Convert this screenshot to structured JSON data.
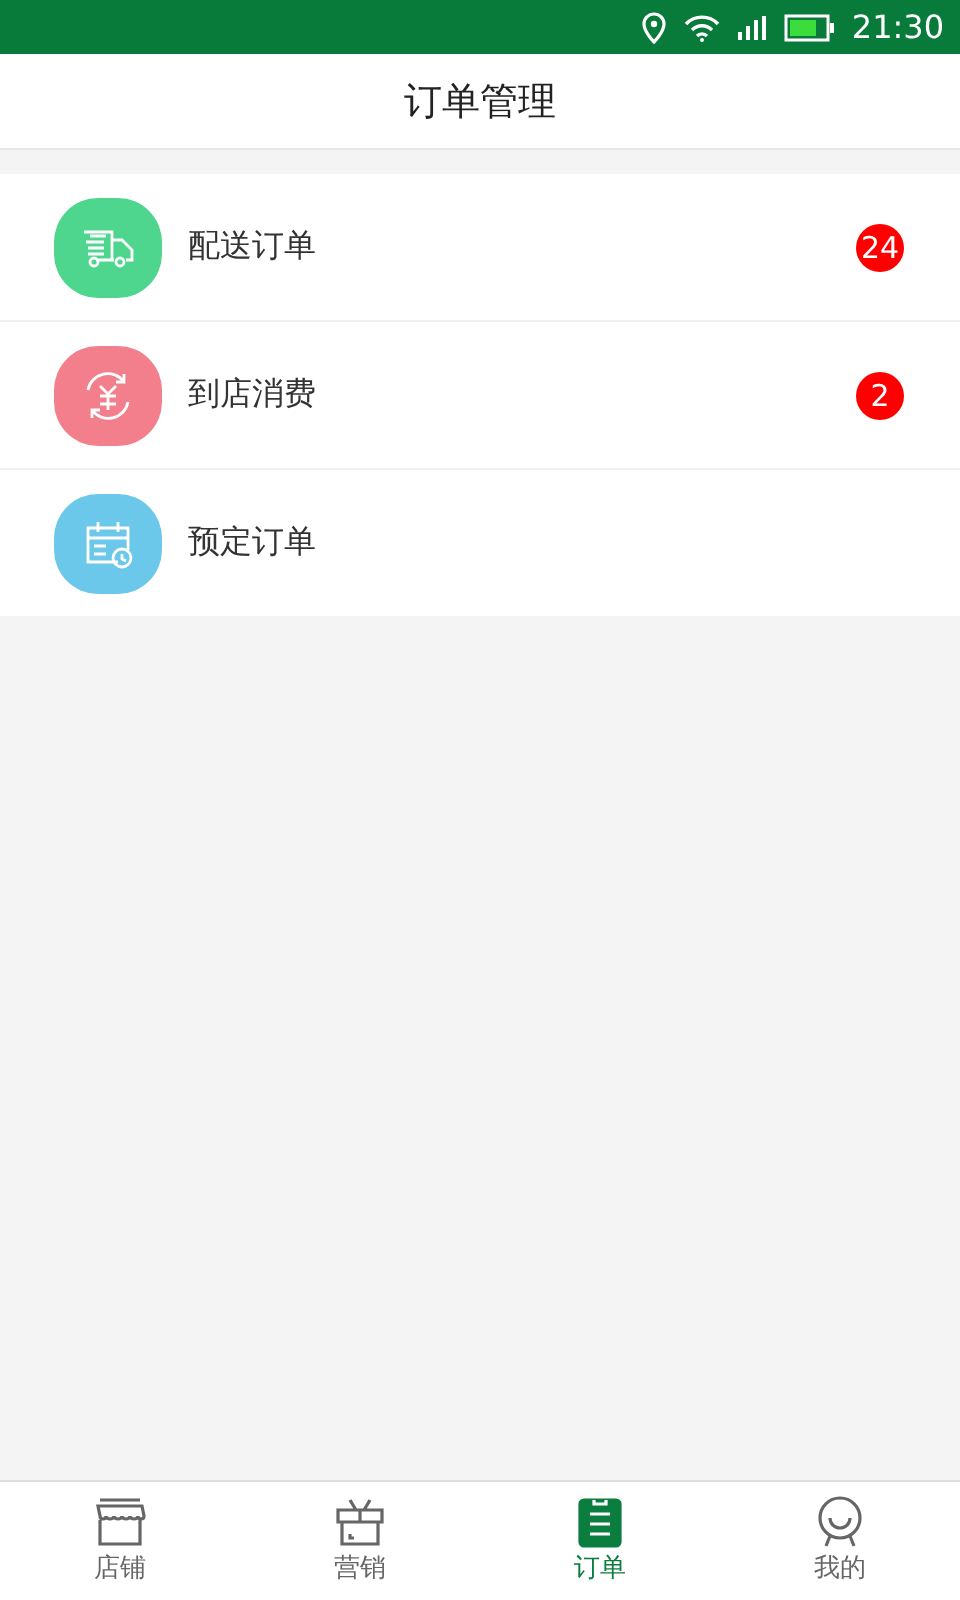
{
  "status_bar": {
    "time": "21:30"
  },
  "header": {
    "title": "订单管理"
  },
  "items": [
    {
      "kind": "truck",
      "color": "#4fd68e",
      "label": "配送订单",
      "badge": "24"
    },
    {
      "kind": "coin",
      "color": "#f47f8c",
      "label": "到店消费",
      "badge": "2"
    },
    {
      "kind": "calendar",
      "color": "#6cc8ea",
      "label": "预定订单"
    }
  ],
  "tabs": [
    {
      "kind": "shop",
      "label": "店铺",
      "selected": false
    },
    {
      "kind": "gift",
      "label": "营销",
      "selected": false
    },
    {
      "kind": "order",
      "label": "订单",
      "selected": true
    },
    {
      "kind": "face",
      "label": "我的",
      "selected": false
    }
  ]
}
